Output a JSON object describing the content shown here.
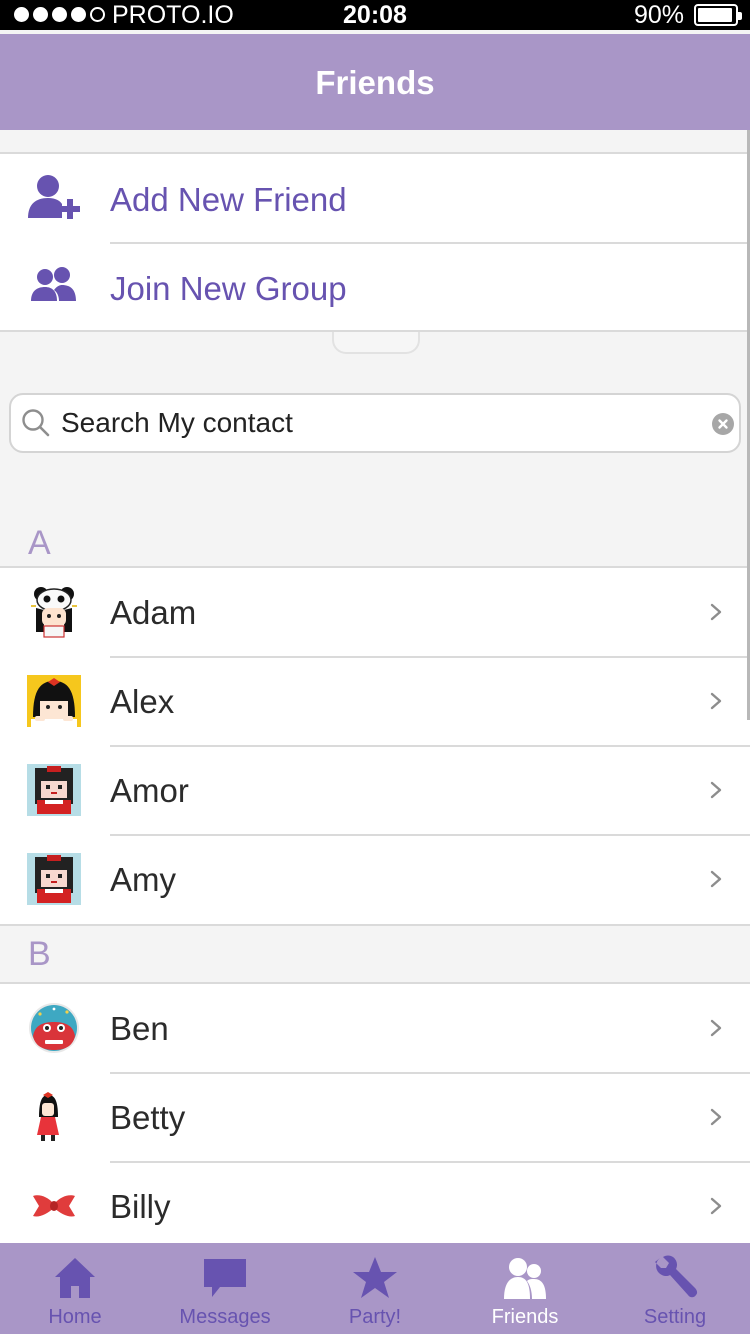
{
  "status_bar": {
    "carrier": "PROTO.IO",
    "time": "20:08",
    "battery": "90%",
    "signal_dots_filled": 4,
    "signal_dots_total": 5
  },
  "nav": {
    "title": "Friends"
  },
  "actions": [
    {
      "label": "Add New Friend",
      "icon": "add-person-icon"
    },
    {
      "label": "Join New Group",
      "icon": "group-icon"
    }
  ],
  "search": {
    "placeholder": "Search My contact"
  },
  "sections": [
    {
      "letter": "A",
      "contacts": [
        {
          "name": "Adam",
          "avatar": "panda-hat-girl-avatar"
        },
        {
          "name": "Alex",
          "avatar": "black-hair-girl-avatar"
        },
        {
          "name": "Amor",
          "avatar": "pixel-girl-avatar"
        },
        {
          "name": "Amy",
          "avatar": "pixel-girl-avatar"
        }
      ]
    },
    {
      "letter": "B",
      "contacts": [
        {
          "name": "Ben",
          "avatar": "round-monster-avatar"
        },
        {
          "name": "Betty",
          "avatar": "red-dress-girl-avatar"
        },
        {
          "name": "Billy",
          "avatar": "red-bow-avatar"
        }
      ]
    }
  ],
  "tabs": [
    {
      "label": "Home",
      "icon": "home-icon"
    },
    {
      "label": "Messages",
      "icon": "chat-bubble-icon"
    },
    {
      "label": "Party!",
      "icon": "star-icon"
    },
    {
      "label": "Friends",
      "icon": "friends-icon",
      "active": true
    },
    {
      "label": "Setting",
      "icon": "wrench-icon"
    }
  ],
  "colors": {
    "brand": "#a996c7",
    "accent": "#6753b0",
    "tab_inactive": "#6753b0",
    "tab_active": "#ffffff"
  }
}
